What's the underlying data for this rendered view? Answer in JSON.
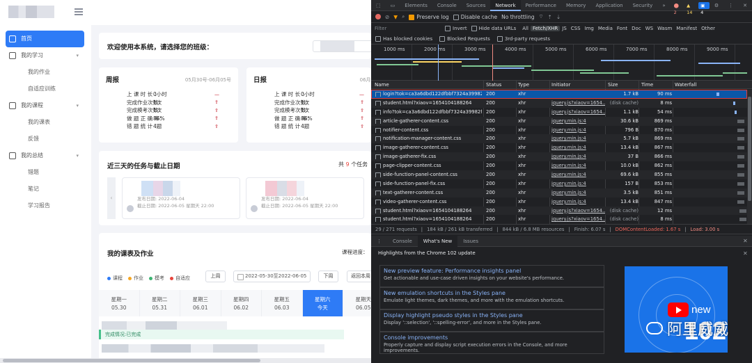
{
  "sidebar": {
    "items": [
      {
        "label": "首页",
        "active": true,
        "type": "top"
      },
      {
        "label": "我的学习",
        "type": "group"
      },
      {
        "label": "我的作业",
        "type": "sub"
      },
      {
        "label": "自适应训练",
        "type": "sub"
      },
      {
        "label": "我的课程",
        "type": "group"
      },
      {
        "label": "我的课表",
        "type": "sub"
      },
      {
        "label": "反馈",
        "type": "sub"
      },
      {
        "label": "我的总结",
        "type": "group"
      },
      {
        "label": "错题",
        "type": "sub"
      },
      {
        "label": "笔记",
        "type": "sub"
      },
      {
        "label": "学习报告",
        "type": "sub"
      }
    ]
  },
  "welcome": {
    "text": "欢迎使用本系统，请选择您的班级："
  },
  "weekly": {
    "title": "周报",
    "range": "05月30号-06月05号",
    "rows": [
      {
        "k": "上 课 时 长 ：",
        "v": "0小时",
        "t": "—"
      },
      {
        "k": "完成作业次数：",
        "v": "1次",
        "t": "⇪"
      },
      {
        "k": "完成模考次数：",
        "v": "1次",
        "t": "⇪"
      },
      {
        "k": "做 题 正 确 率：",
        "v": "86%",
        "t": "⇪"
      },
      {
        "k": "错 题 统 计 ：",
        "v": "4题",
        "t": "⇪"
      }
    ]
  },
  "daily": {
    "title": "日报",
    "range": "06月0",
    "rows": [
      {
        "k": "上 课 时 长 ：",
        "v": "0小时",
        "t": "—"
      },
      {
        "k": "完成作业次数：",
        "v": "1次",
        "t": "⇪"
      },
      {
        "k": "完成模考次数：",
        "v": "1次",
        "t": "⇪"
      },
      {
        "k": "做 题 正 确 率：",
        "v": "86%",
        "t": "⇪"
      },
      {
        "k": "错 题 统 计 ：",
        "v": "4题",
        "t": "⇪"
      }
    ]
  },
  "tasks": {
    "title": "近三天的任务与截止日期",
    "count_prefix": "共",
    "count": "9",
    "count_suffix": "个任务",
    "cards": [
      {
        "published": "发布日期: 2022-06-04",
        "deadline": "截止日期: 2022-06-05 星期天 22:00"
      },
      {
        "published": "发布日期: 2022-06-04",
        "deadline": "截止日期: 2022-06-05 星期天 22:00"
      }
    ]
  },
  "schedule": {
    "title": "我的课表及作业",
    "progress_label": "课程进度：",
    "legend": [
      {
        "label": "课程",
        "color": "#2e7bf6"
      },
      {
        "label": "作业",
        "color": "#f5a623"
      },
      {
        "label": "模考",
        "color": "#3cb371"
      },
      {
        "label": "自适应",
        "color": "#e8453c"
      }
    ],
    "prev_week": "上周",
    "date_range": "2022-05-30至2022-06-05",
    "next_week": "下周",
    "back_this_week": "返回本周",
    "days": [
      {
        "name": "星期一",
        "date": "05.30"
      },
      {
        "name": "星期二",
        "date": "05.31"
      },
      {
        "name": "星期三",
        "date": "06.01"
      },
      {
        "name": "星期四",
        "date": "06.02"
      },
      {
        "name": "星期五",
        "date": "06.03"
      },
      {
        "name": "星期六",
        "date": "今天",
        "today": true
      },
      {
        "name": "星期天",
        "date": "06.05"
      }
    ],
    "done_label": "完成情况:已完成"
  },
  "devtools": {
    "tabs": [
      "Elements",
      "Console",
      "Sources",
      "Network",
      "Performance",
      "Memory",
      "Application",
      "Security"
    ],
    "active_tab": "Network",
    "more": "»",
    "errors": "2",
    "warnings": "14",
    "issues": "4",
    "toolbar": {
      "preserve_log": "Preserve log",
      "disable_cache": "Disable cache",
      "throttling": "No throttling"
    },
    "filter": {
      "placeholder": "Filter",
      "invert": "Invert",
      "hide_data": "Hide data URLs",
      "types": [
        "All",
        "Fetch/XHR",
        "JS",
        "CSS",
        "Img",
        "Media",
        "Font",
        "Doc",
        "WS",
        "Wasm",
        "Manifest",
        "Other"
      ],
      "active_type": "Fetch/XHR",
      "blocked_cookies": "Has blocked cookies",
      "blocked_requests": "Blocked Requests",
      "third_party": "3rd-party requests"
    },
    "timeline_labels": [
      "1000 ms",
      "2000 ms",
      "3000 ms",
      "4000 ms",
      "5000 ms",
      "6000 ms",
      "7000 ms",
      "8000 ms",
      "9000 ms"
    ],
    "columns": [
      "Name",
      "Status",
      "Type",
      "Initiator",
      "Size",
      "Time",
      "Waterfall"
    ],
    "requests": [
      {
        "name": "login?tok=ca3a6dbd122dfbbf7324a39982...",
        "status": "200",
        "type": "xhr",
        "initiator": "",
        "size": "1.7 kB",
        "time": "90 ms",
        "selected": true,
        "wf": 0.6
      },
      {
        "name": "student.html?xiaov=16541041882​64",
        "status": "200",
        "type": "xhr",
        "initiator": "jquery.js?xiaov=1654...",
        "size": "(disk cache)",
        "time": "8 ms",
        "wf": 0.84
      },
      {
        "name": "info?tok=ca3a6dbd122dfbbf7324a39982f...",
        "status": "200",
        "type": "xhr",
        "initiator": "jquery.js?xiaov=1654...",
        "size": "1.1 kB",
        "time": "54 ms",
        "wf": 0.86
      },
      {
        "name": "article-gatherer-content.css",
        "status": "200",
        "type": "xhr",
        "initiator": "jquery.min.js:4",
        "size": "30.6 kB",
        "time": "869 ms",
        "wf": 0.9
      },
      {
        "name": "notifier-content.css",
        "status": "200",
        "type": "xhr",
        "initiator": "jquery.min.js:4",
        "size": "796 B",
        "time": "870 ms",
        "wf": 0.9
      },
      {
        "name": "notification-manager-content.css",
        "status": "200",
        "type": "xhr",
        "initiator": "jquery.min.js:4",
        "size": "5.7 kB",
        "time": "869 ms",
        "wf": 0.9
      },
      {
        "name": "image-gatherer-content.css",
        "status": "200",
        "type": "xhr",
        "initiator": "jquery.min.js:4",
        "size": "13.4 kB",
        "time": "867 ms",
        "wf": 0.9
      },
      {
        "name": "image-gatherer-fix.css",
        "status": "200",
        "type": "xhr",
        "initiator": "jquery.min.js:4",
        "size": "37 B",
        "time": "866 ms",
        "wf": 0.9
      },
      {
        "name": "page-clipper-content.css",
        "status": "200",
        "type": "xhr",
        "initiator": "jquery.min.js:4",
        "size": "10.0 kB",
        "time": "862 ms",
        "wf": 0.9
      },
      {
        "name": "side-function-panel-content.css",
        "status": "200",
        "type": "xhr",
        "initiator": "jquery.min.js:4",
        "size": "69.6 kB",
        "time": "855 ms",
        "wf": 0.9
      },
      {
        "name": "side-function-panel-fix.css",
        "status": "200",
        "type": "xhr",
        "initiator": "jquery.min.js:4",
        "size": "157 B",
        "time": "853 ms",
        "wf": 0.9
      },
      {
        "name": "text-gatherer-content.css",
        "status": "200",
        "type": "xhr",
        "initiator": "jquery.min.js:4",
        "size": "3.5 kB",
        "time": "851 ms",
        "wf": 0.9
      },
      {
        "name": "video-gatherer-content.css",
        "status": "200",
        "type": "xhr",
        "initiator": "jquery.min.js:4",
        "size": "13.4 kB",
        "time": "847 ms",
        "wf": 0.9
      },
      {
        "name": "student.html?xiaov=1654104188264",
        "status": "200",
        "type": "xhr",
        "initiator": "jquery.js?xiaov=1654...",
        "size": "(disk cache)",
        "time": "12 ms",
        "wf": 0.93
      },
      {
        "name": "student.html?xiaov=1654104188264",
        "status": "200",
        "type": "xhr",
        "initiator": "jquery.js?xiaov=1654...",
        "size": "(disk cache)",
        "time": "8 ms",
        "wf": 0.93
      }
    ],
    "status": {
      "requests": "29 / 271 requests",
      "transferred": "184 kB / 261 kB transferred",
      "resources": "844 kB / 6.8 MB resources",
      "finish": "Finish: 6.07 s",
      "dcl": "DOMContentLoaded: 1.67 s",
      "load": "Load: 3.00 s"
    },
    "drawer_tabs": [
      "Console",
      "What's New",
      "Issues"
    ],
    "drawer_active": "What's New",
    "highlights": "Highlights from the Chrome 102 update",
    "news": [
      {
        "title": "New preview feature: Performance insights panel",
        "desc": "Get actionable and use-case driven insights on your website's performance."
      },
      {
        "title": "New emulation shortcuts in the Styles pane",
        "desc": "Emulate light themes, dark themes, and more with the emulation shortcuts."
      },
      {
        "title": "Display highlight pseudo styles in the Styles pane",
        "desc": "Display '::selection', '::spelling-error', and more in the Styles pane."
      },
      {
        "title": "Console improvements",
        "desc": "Properly capture and display script execution errors in the Console, and more improvements."
      }
    ],
    "promo": {
      "new": "new",
      "version": "102"
    }
  },
  "watermark": {
    "text": "阿里威威"
  },
  "colors": {
    "accent": "#2e7bf6",
    "devtools_bg": "#202124",
    "selected_row": "#0b57a8",
    "link": "#8ab4f8"
  }
}
